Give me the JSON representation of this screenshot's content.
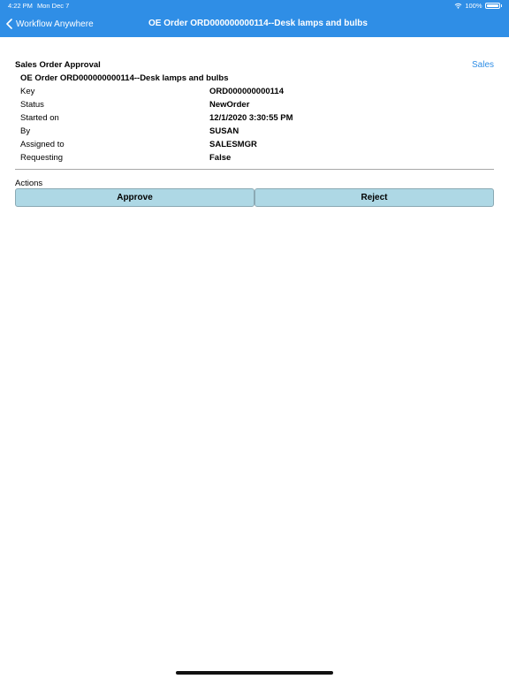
{
  "status_bar": {
    "time": "4:22 PM",
    "date": "Mon Dec 7",
    "battery": "100%"
  },
  "nav": {
    "back_label": "Workflow Anywhere",
    "title": "OE Order ORD000000000114--Desk lamps and bulbs"
  },
  "card": {
    "title": "Sales Order Approval",
    "link": "Sales",
    "order_title": "OE Order ORD000000000114--Desk lamps and bulbs",
    "rows": [
      {
        "label": "Key",
        "value": "ORD000000000114"
      },
      {
        "label": "Status",
        "value": "NewOrder"
      },
      {
        "label": "Started on",
        "value": "12/1/2020 3:30:55 PM"
      },
      {
        "label": "By",
        "value": "SUSAN"
      },
      {
        "label": "Assigned to",
        "value": "SALESMGR"
      },
      {
        "label": "Requesting",
        "value": "False"
      }
    ]
  },
  "actions": {
    "label": "Actions",
    "approve": "Approve",
    "reject": "Reject"
  },
  "colors": {
    "header": "#2f8ee6",
    "button": "#aed8e5",
    "link": "#2f8ee6"
  }
}
